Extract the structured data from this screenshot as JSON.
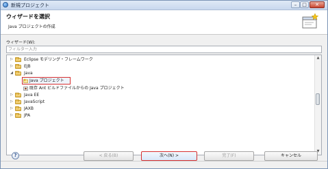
{
  "window": {
    "title": "新規プロジェクト",
    "minimize": "–",
    "maximize": "□",
    "close": "✕"
  },
  "banner": {
    "title": "ウィザードを選択",
    "subtitle": "Java プロジェクトの作成"
  },
  "wizards": {
    "label": "ウィザード(W):",
    "filter_placeholder": "フィルター入力",
    "filter_value": "",
    "tree": [
      {
        "label": "Eclipse モデリング・フレームワーク",
        "expander": "▷",
        "icon": "folder-icon"
      },
      {
        "label": "EJB",
        "expander": "▷",
        "icon": "folder-icon"
      },
      {
        "label": "Java",
        "expander": "◢",
        "icon": "folder-icon"
      },
      {
        "label": "Java プロジェクト",
        "expander": "",
        "icon": "java-project-icon"
      },
      {
        "label": "既存 Ant ビルドファイルからの Java プロジェクト",
        "expander": "",
        "icon": "ant-project-icon"
      },
      {
        "label": "Java EE",
        "expander": "▷",
        "icon": "folder-icon"
      },
      {
        "label": "JavaScript",
        "expander": "▷",
        "icon": "folder-icon"
      },
      {
        "label": "JAXB",
        "expander": "▷",
        "icon": "folder-icon"
      },
      {
        "label": "JPA",
        "expander": "▷",
        "icon": "folder-icon"
      }
    ],
    "scroll_up": "▲",
    "scroll_down": "▼"
  },
  "buttons": {
    "help": "?",
    "back": "< 戻る(B)",
    "next": "次へ(N) >",
    "finish": "完了(F)",
    "cancel": "キャンセル"
  },
  "colors": {
    "selection_outline": "#d62e2e",
    "folder": "#e6bb52",
    "title_bar": "#c8d8ee"
  }
}
